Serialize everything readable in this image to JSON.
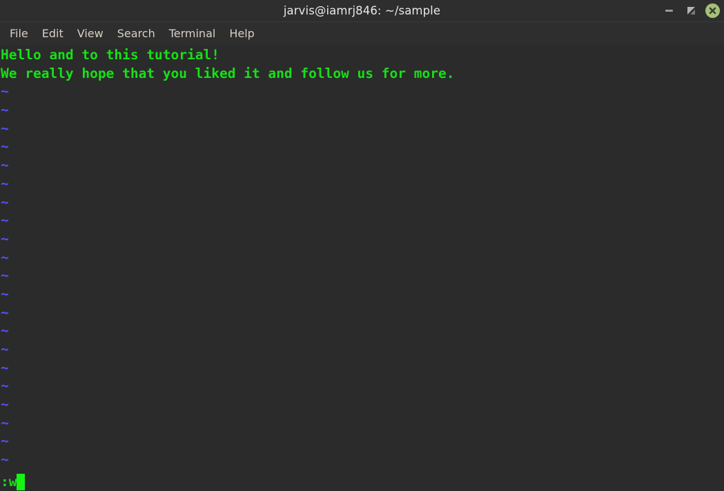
{
  "window": {
    "title": "jarvis@iamrj846: ~/sample",
    "controls": {
      "minimize_label": "minimize",
      "maximize_label": "restore",
      "close_label": "close"
    },
    "colors": {
      "titlebar_bg": "#2e2e2e",
      "terminal_bg": "#2b2b2b",
      "close_button": "#a6c079",
      "text_green": "#17e017",
      "tilde_blue": "#5151fa",
      "menu_text": "#d7cfc4"
    }
  },
  "menubar": {
    "items": [
      {
        "label": "File"
      },
      {
        "label": "Edit"
      },
      {
        "label": "View"
      },
      {
        "label": "Search"
      },
      {
        "label": "Terminal"
      },
      {
        "label": "Help"
      }
    ]
  },
  "terminal": {
    "buffer_lines": [
      "Hello and to this tutorial!",
      "We really hope that you liked it and follow us for more."
    ],
    "empty_line_marker": "~",
    "empty_line_count": 21,
    "command_line": ":w",
    "cursor": "block"
  }
}
